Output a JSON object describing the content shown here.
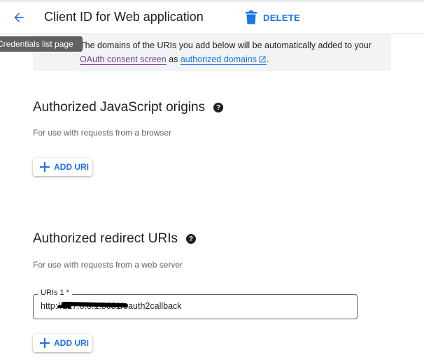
{
  "header": {
    "title": "Client ID for Web application",
    "delete_label": "DELETE",
    "accent_color": "#1a73e8"
  },
  "tooltip": {
    "text": "Credentials list page"
  },
  "info": {
    "text_before": "The domains of the URIs you add below will be automatically added to your ",
    "consent_link": "OAuth consent screen",
    "text_middle": " as ",
    "domains_link": "authorized domains",
    "text_after": "."
  },
  "js_origins": {
    "title": "Authorized JavaScript origins",
    "subtitle": "For use with requests from a browser",
    "add_label": "ADD URI"
  },
  "redirect_uris": {
    "title": "Authorized redirect URIs",
    "subtitle": "For use with requests from a web server",
    "field_label": "URIs 1 *",
    "field_value": "http://127.0.0.1:8081/oauth2callback",
    "add_label": "ADD URI"
  },
  "icons": {
    "back": "arrow-back-icon",
    "delete": "trash-icon",
    "help": "help-icon",
    "external": "external-link-icon",
    "add": "plus-icon"
  }
}
